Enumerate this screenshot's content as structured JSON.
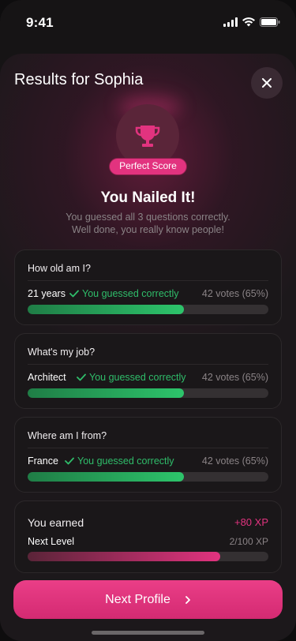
{
  "status_bar": {
    "time": "9:41"
  },
  "header": {
    "title": "Results for Sophia"
  },
  "result": {
    "badge": "Perfect Score",
    "headline": "You Nailed It!",
    "subtext_line1": "You guessed all 3 questions correctly.",
    "subtext_line2": "Well done, you really know people!"
  },
  "questions": [
    {
      "question": "How old am I?",
      "answer": "21 years",
      "status": "You guessed correctly",
      "votes": "42 votes (65%)",
      "percent": 0.65
    },
    {
      "question": "What's my job?",
      "answer": "Architect",
      "status": "You guessed correctly",
      "votes": "42 votes (65%)",
      "percent": 0.65
    },
    {
      "question": "Where am I from?",
      "answer": "France",
      "status": "You guessed correctly",
      "votes": "42 votes (65%)",
      "percent": 0.65
    }
  ],
  "xp": {
    "earned_label": "You earned",
    "earned_value": "+80 XP",
    "level_label": "Next Level",
    "level_value": "2/100 XP",
    "level_progress": 0.8
  },
  "cta": {
    "label": "Next Profile"
  },
  "colors": {
    "accent": "#e2337f",
    "success": "#2fbd6a",
    "background": "#1c181b"
  }
}
